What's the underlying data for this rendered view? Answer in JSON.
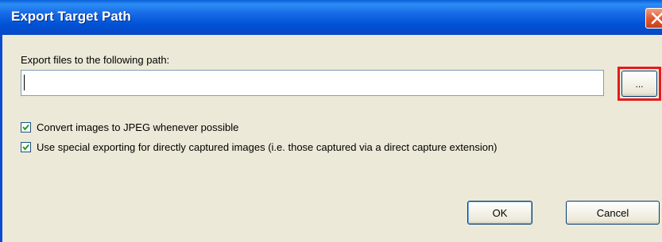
{
  "window": {
    "title": "Export Target Path",
    "close_icon": "close-icon",
    "accent_color": "#0a5fd8",
    "close_color": "#e05a30"
  },
  "path": {
    "label": "Export files to the following path:",
    "value": "",
    "browse_label": "...",
    "highlight_color": "#e41c1c"
  },
  "options": [
    {
      "label": "Convert images to JPEG whenever possible",
      "checked": true
    },
    {
      "label": "Use special exporting for directly captured images (i.e. those captured via a direct capture extension)",
      "checked": true
    }
  ],
  "buttons": {
    "ok": "OK",
    "cancel": "Cancel"
  }
}
